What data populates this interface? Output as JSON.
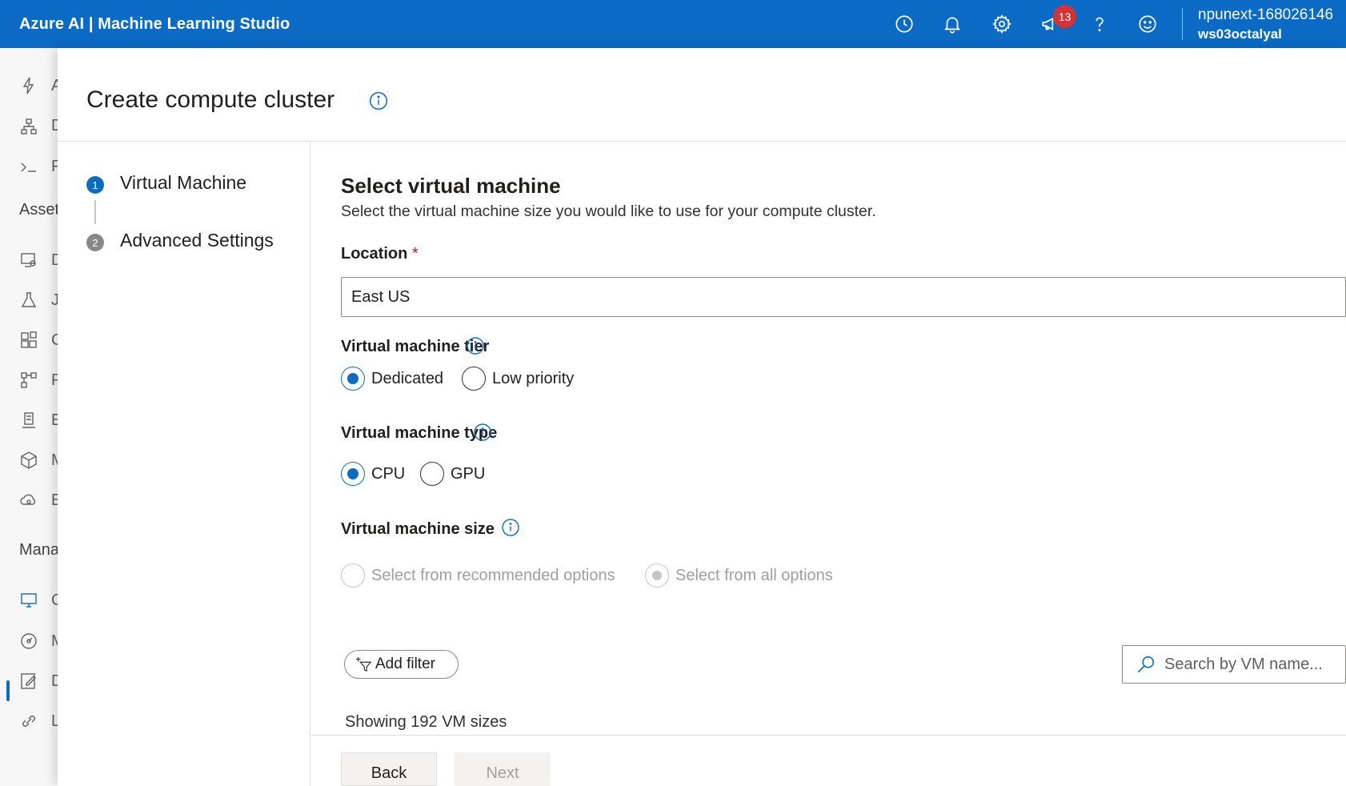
{
  "topbar": {
    "title": "Azure AI | Machine Learning Studio",
    "notification_count": "13",
    "user_name": "npunext-168026146",
    "workspace": "ws03octalyal",
    "colors": {
      "bar": "#0b6ac3",
      "badge": "#d13438"
    }
  },
  "leftnav": {
    "items_top": [
      {
        "icon": "lightning-icon",
        "label": "A"
      },
      {
        "icon": "diagram-icon",
        "label": "D"
      },
      {
        "icon": "terminal-icon",
        "label": "P"
      }
    ],
    "assets_label": "Asset",
    "asset_items": [
      {
        "icon": "data-icon",
        "label": "D"
      },
      {
        "icon": "flask-icon",
        "label": "J"
      },
      {
        "icon": "components-icon",
        "label": "C"
      },
      {
        "icon": "pipeline-icon",
        "label": "P"
      },
      {
        "icon": "environment-icon",
        "label": "E"
      },
      {
        "icon": "model-icon",
        "label": "M"
      },
      {
        "icon": "endpoint-icon",
        "label": "E"
      }
    ],
    "manage_label": "Mana",
    "manage_items": [
      {
        "icon": "compute-icon",
        "label": "C"
      },
      {
        "icon": "monitor-icon",
        "label": "M"
      },
      {
        "icon": "edit-icon",
        "label": "D"
      },
      {
        "icon": "link-icon",
        "label": "L"
      }
    ]
  },
  "panel": {
    "title": "Create compute cluster",
    "steps": [
      {
        "number": "1",
        "label": "Virtual Machine"
      },
      {
        "number": "2",
        "label": "Advanced Settings"
      }
    ],
    "section_title": "Select virtual machine",
    "section_desc": "Select the virtual machine size you would like to use for your compute cluster.",
    "location_label": "Location",
    "location_required": "*",
    "location_value": "East US",
    "tier_label": "Virtual machine tier",
    "tier_options": [
      "Dedicated",
      "Low priority"
    ],
    "tier_selected": "Dedicated",
    "type_label": "Virtual machine type",
    "type_options": [
      "CPU",
      "GPU"
    ],
    "type_selected": "CPU",
    "size_label": "Virtual machine size",
    "size_options": [
      "Select from recommended options",
      "Select from all options"
    ],
    "size_selected": "Select from all options",
    "add_filter": "Add filter",
    "search_placeholder": "Search by VM name...",
    "showing": "Showing 192 VM sizes",
    "back": "Back",
    "next": "Next"
  }
}
